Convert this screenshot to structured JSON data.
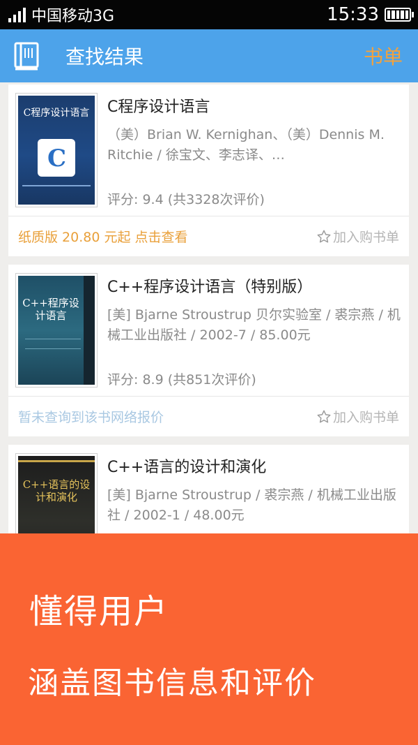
{
  "status_bar": {
    "carrier": "中国移动3G",
    "time": "15:33",
    "signal_icon": "signal-bars-icon",
    "battery_icon": "battery-full-icon"
  },
  "header": {
    "icon": "book-icon",
    "title": "查找结果",
    "action_label": "书单",
    "background": "#4da3ea",
    "action_color": "#f3a23c"
  },
  "books": [
    {
      "title": "C程序设计语言",
      "authors": "（美）Brian W. Kernighan、（美）Dennis M. Ritchie / 徐宝文、李志译、…",
      "rating": "评分: 9.4 (共3328次评价)",
      "price_text": "纸质版 20.80 元起 点击查看",
      "add_label": "加入购书单",
      "cover_title": "C程序设计语言"
    },
    {
      "title": "C++程序设计语言（特别版）",
      "authors": "[美] Bjarne Stroustrup 贝尔实验室 / 裘宗燕 / 机械工业出版社 / 2002-7 / 85.00元",
      "rating": "评分: 8.9 (共851次评价)",
      "price_text": "暂未查询到该书网络报价",
      "add_label": "加入购书单",
      "cover_title": "C++程序设计语言"
    },
    {
      "title": "C++语言的设计和演化",
      "authors": "[美] Bjarne Stroustrup / 裘宗燕 / 机械工业出版社 / 2002-1 / 48.00元",
      "cover_title": "C++语言的设计和演化"
    }
  ],
  "promo": {
    "line1": "懂得用户",
    "line2": "涵盖图书信息和评价",
    "background": "#fa6433"
  },
  "colors": {
    "price_available": "#e9a03a",
    "price_unavailable": "#a9c8e2",
    "muted_text": "#8a8a8a"
  }
}
